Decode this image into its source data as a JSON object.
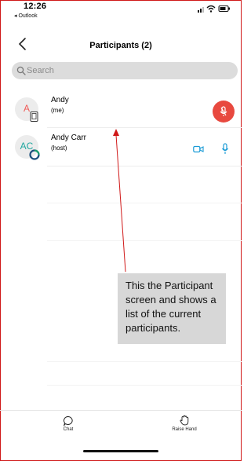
{
  "status_bar": {
    "time": "12:26",
    "back_app": "◂ Outlook",
    "signal_icon": "signal-icon",
    "wifi_icon": "wifi-icon",
    "battery_icon": "battery-icon"
  },
  "header": {
    "back_icon": "chevron-left-icon",
    "title": "Participants (2)"
  },
  "search": {
    "placeholder": "Search"
  },
  "participants": [
    {
      "initials": "A",
      "name": "Andy",
      "role": "(me)",
      "avatar_color": "#f05a57",
      "badge": "phone-icon",
      "controls": [
        "mic-muted-icon"
      ],
      "mic_button_color": "#e8493f"
    },
    {
      "initials": "AC",
      "name": "Andy Carr",
      "role": "(host)",
      "avatar_color": "#20a79f",
      "badge": "refresh-ring-icon",
      "controls": [
        "video-icon",
        "mic-icon"
      ],
      "control_color": "#1a9bd6"
    }
  ],
  "annotation": {
    "text": "This the Participant screen and shows a list of the current participants.",
    "color": "#d01818"
  },
  "bottom_bar": {
    "chat_label": "Chat",
    "raise_hand_label": "Raise Hand"
  }
}
